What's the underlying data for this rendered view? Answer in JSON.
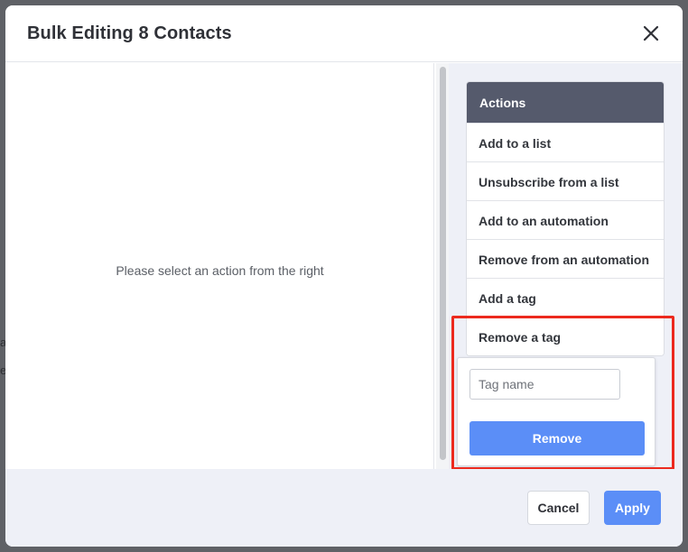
{
  "background": {
    "peek_text_1": "a",
    "peek_text_2": "e"
  },
  "modal": {
    "title": "Bulk Editing 8 Contacts",
    "close_icon": "close-icon"
  },
  "left_pane": {
    "message": "Please select an action from the right"
  },
  "actions": {
    "heading": "Actions",
    "items": [
      {
        "label": "Add to a list"
      },
      {
        "label": "Unsubscribe from a list"
      },
      {
        "label": "Add to an automation"
      },
      {
        "label": "Remove from an automation"
      },
      {
        "label": "Add a tag"
      },
      {
        "label": "Remove a tag"
      }
    ]
  },
  "popover": {
    "input_placeholder": "Tag name",
    "input_value": "",
    "button_label": "Remove"
  },
  "footer": {
    "cancel_label": "Cancel",
    "apply_label": "Apply"
  },
  "colors": {
    "header_dark": "#555a6c",
    "primary_blue": "#5b8ef7",
    "highlight_red": "#ec2a1e",
    "panel_bg": "#eef0f7"
  }
}
